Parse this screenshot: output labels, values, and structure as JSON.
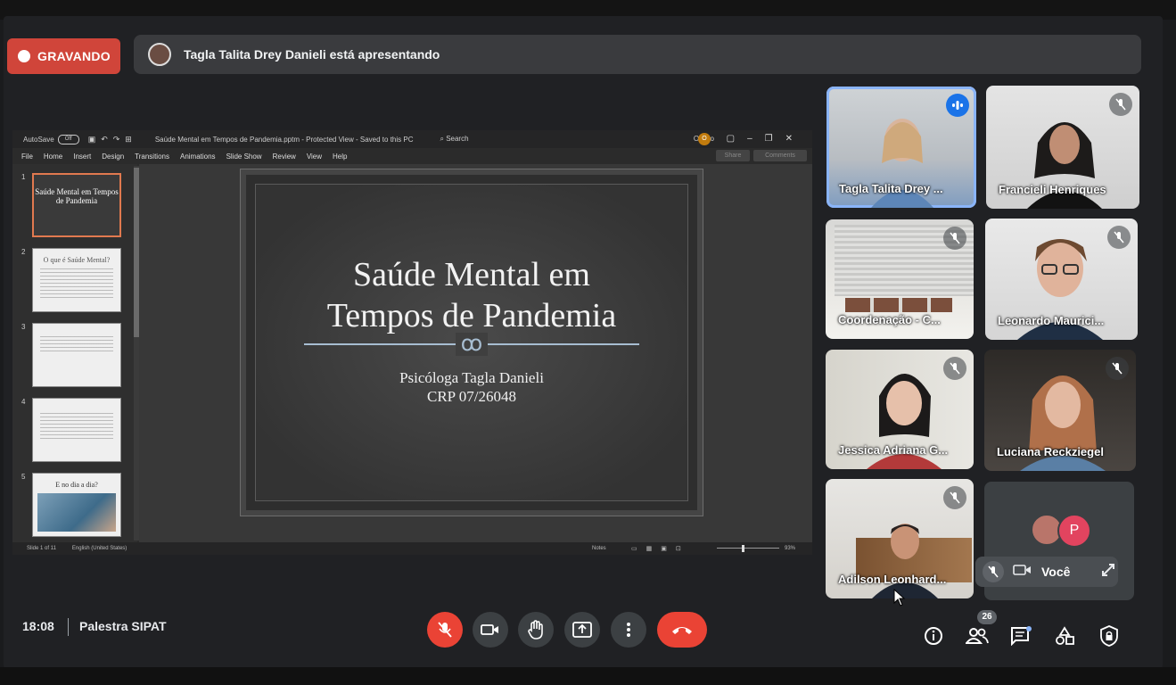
{
  "recording": {
    "label": "GRAVANDO"
  },
  "presenting": {
    "text": "Tagla Talita Drey Danieli está apresentando"
  },
  "ppt": {
    "autosave": "AutoSave",
    "autosave_state": "Off",
    "file_title": "Saúde Mental em Tempos de Pandemia.pptm  -  Protected View  -  Saved to this PC",
    "search": "Search",
    "user": "Otavio",
    "user_initial": "O",
    "menu": [
      "File",
      "Home",
      "Insert",
      "Design",
      "Transitions",
      "Animations",
      "Slide Show",
      "Review",
      "View",
      "Help"
    ],
    "share": "Share",
    "comments": "Comments",
    "thumbnails": [
      {
        "num": "1",
        "title": "Saúde Mental em Tempos de Pandemia"
      },
      {
        "num": "2",
        "title": "O que é Saúde Mental?"
      },
      {
        "num": "3",
        "title": ""
      },
      {
        "num": "4",
        "title": ""
      },
      {
        "num": "5",
        "title": "E no dia a dia?"
      }
    ],
    "slide": {
      "title_line1": "Saúde Mental em",
      "title_line2": "Tempos de Pandemia",
      "ornament": "ꝏ",
      "sub_line1": "Psicóloga Tagla Danieli",
      "sub_line2": "CRP 07/26048"
    },
    "status": {
      "slide_of": "Slide 1 of 11",
      "language": "English (United States)",
      "notes": "Notes",
      "zoom": "93%"
    }
  },
  "participants": [
    {
      "name": "Tagla Talita Drey ...",
      "speaking": true
    },
    {
      "name": "Francieli Henriques",
      "speaking": false
    },
    {
      "name": "Coordenação - C...",
      "speaking": false
    },
    {
      "name": "Leonardo Maurici...",
      "speaking": false
    },
    {
      "name": "Jessica Adriana G...",
      "speaking": false
    },
    {
      "name": "Luciana Reckziegel",
      "speaking": false
    },
    {
      "name": "Adilson Leonhard...",
      "speaking": false
    }
  ],
  "self": {
    "name": "Você",
    "avatar_letter": "P"
  },
  "bottom": {
    "time": "18:08",
    "meeting_name": "Palestra SIPAT",
    "people_count": "26"
  },
  "colors": {
    "record": "#d0453a",
    "hangup": "#ea4335",
    "active_outline": "#8ab4f8",
    "speaking": "#1a73e8"
  }
}
